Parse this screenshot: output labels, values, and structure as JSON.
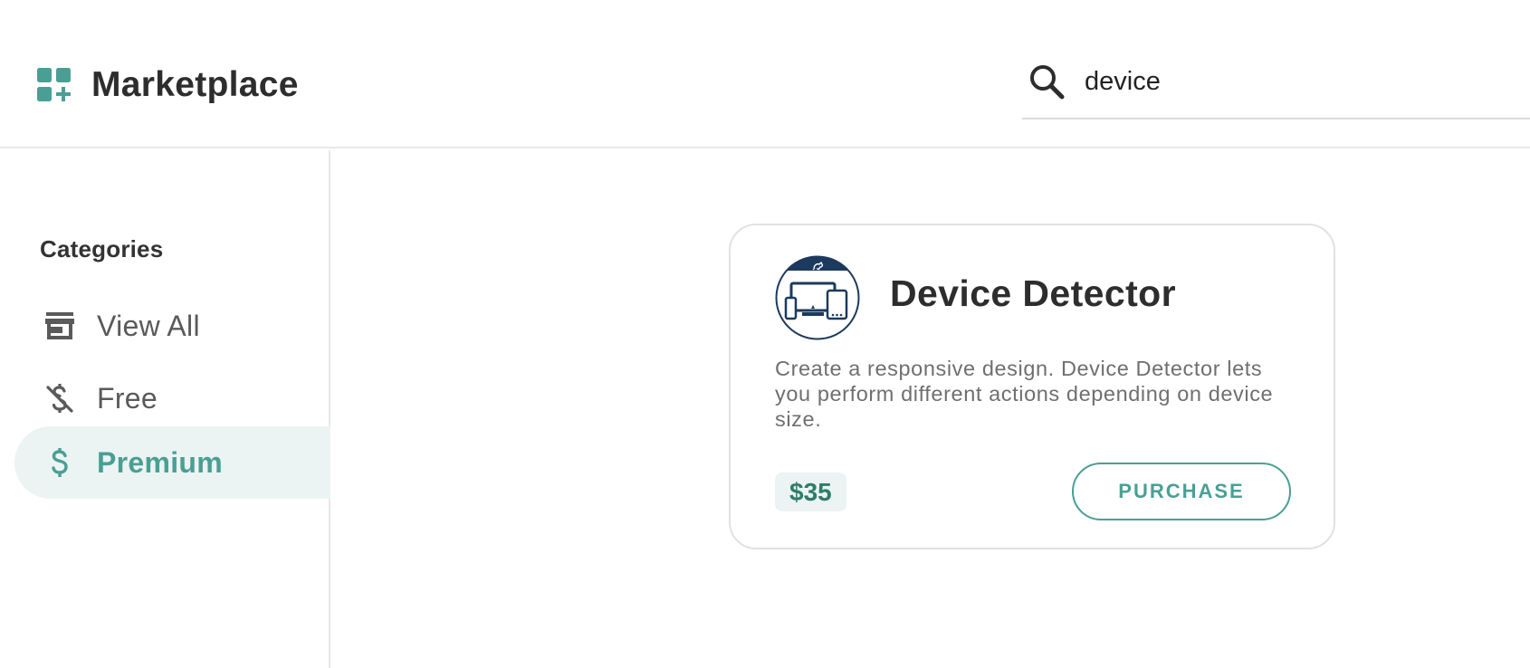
{
  "header": {
    "title": "Marketplace",
    "brand_icon": "apps-add-icon",
    "accent_color": "#4a9f94"
  },
  "search": {
    "value": "device",
    "placeholder": "",
    "icon": "search-icon"
  },
  "sidebar": {
    "heading": "Categories",
    "items": [
      {
        "label": "View All",
        "icon": "store-icon",
        "active": false
      },
      {
        "label": "Free",
        "icon": "money-off-icon",
        "active": false
      },
      {
        "label": "Premium",
        "icon": "dollar-icon",
        "active": true
      }
    ]
  },
  "product": {
    "name": "Device Detector",
    "description": "Create a responsive design. Device Detector lets you perform different actions depending on device size.",
    "price": "$35",
    "action_label": "PURCHASE",
    "logo": "device-detector-logo"
  }
}
